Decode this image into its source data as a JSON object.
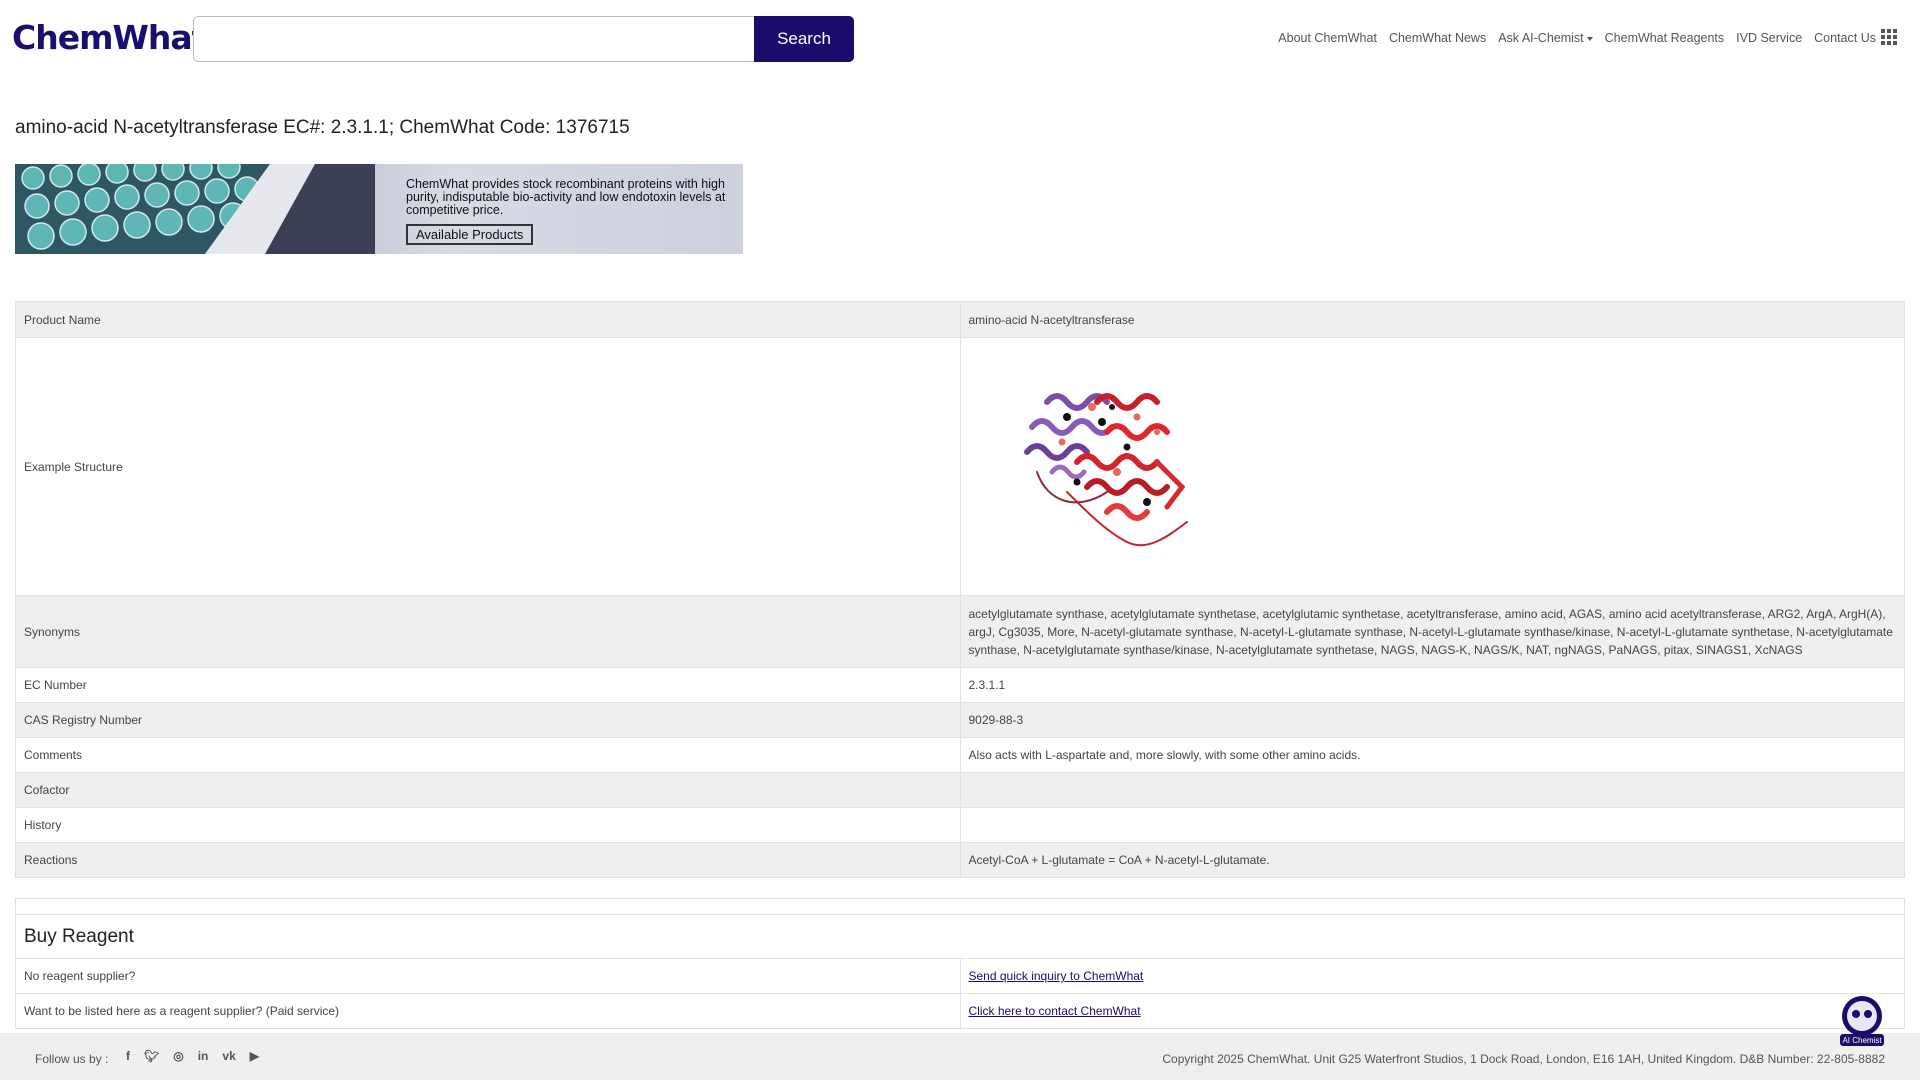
{
  "header": {
    "logo": "ChemWhat",
    "search_placeholder": "",
    "search_button": "Search",
    "nav": [
      {
        "label": "About ChemWhat"
      },
      {
        "label": "ChemWhat News"
      },
      {
        "label": "Ask AI-Chemist",
        "dropdown": true
      },
      {
        "label": "ChemWhat Reagents"
      },
      {
        "label": "IVD Service"
      },
      {
        "label": "Contact Us"
      }
    ],
    "apps_icon": "grid-icon"
  },
  "page_title": "amino-acid N-acetyltransferase EC#: 2.3.1.1; ChemWhat Code: 1376715",
  "banner": {
    "text": "ChemWhat provides stock recombinant proteins with high purity, indisputable bio-activity and low endotoxin levels at competitive price.",
    "button": "Available Products"
  },
  "info_rows": [
    {
      "label": "Product Name",
      "value": "amino-acid N-acetyltransferase"
    },
    {
      "label": "Example Structure",
      "value": ""
    },
    {
      "label": "Synonyms",
      "value": "acetylglutamate synthase, acetylglutamate synthetase, acetylglutamic synthetase, acetyltransferase, amino acid, AGAS, amino acid acetyltransferase, ARG2, ArgA, ArgH(A), argJ, Cg3035, More, N-acetyl-glutamate synthase, N-acetyl-L-glutamate synthase, N-acetyl-L-glutamate synthase/kinase, N-acetyl-L-glutamate synthetase, N-acetylglutamate synthase, N-acetylglutamate synthase/kinase, N-acetylglutamate synthetase, NAGS, NAGS-K, NAGS/K, NAT, ngNAGS, PaNAGS, pitax, SINAGS1, XcNAGS"
    },
    {
      "label": "EC Number",
      "value": "2.3.1.1"
    },
    {
      "label": "CAS Registry Number",
      "value": "9029-88-3"
    },
    {
      "label": "Comments",
      "value": "Also acts with L-aspartate and, more slowly, with some other amino acids."
    },
    {
      "label": "Cofactor",
      "value": ""
    },
    {
      "label": "History",
      "value": ""
    },
    {
      "label": "Reactions",
      "value": "Acetyl-CoA + L-glutamate = CoA + N-acetyl-L-glutamate."
    }
  ],
  "buy": {
    "heading": "Buy Reagent",
    "rows": [
      {
        "label": "No reagent supplier?",
        "link": "Send quick inquiry to ChemWhat"
      },
      {
        "label": "Want to be listed here as a reagent supplier? (Paid service)",
        "link": "Click here to contact ChemWhat"
      }
    ]
  },
  "footer": {
    "follow": "Follow us by :",
    "social": [
      "facebook-icon",
      "twitter-icon",
      "instagram-icon",
      "linkedin-icon",
      "vk-icon",
      "youtube-icon"
    ],
    "copyright": "Copyright 2025 ChemWhat. Unit G25 Waterfront Studios, 1 Dock Road, London, E16 1AH, United Kingdom. D&B Number: 22-805-8882"
  },
  "colors": {
    "brand": "#1a0c6b",
    "row_alt": "#efefef"
  }
}
